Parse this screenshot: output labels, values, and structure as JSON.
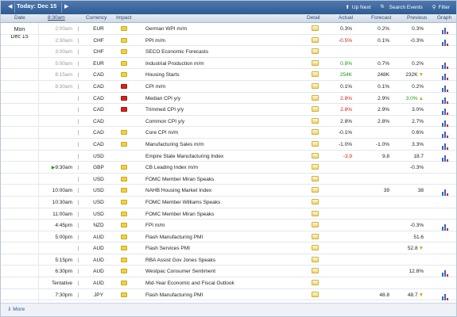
{
  "nav": {
    "prev_icon": "◀",
    "today": "Today: Dec 15",
    "next_icon": "▶",
    "up_next": "Up Next",
    "search": "Search Events",
    "filter": "Filter"
  },
  "columns": {
    "date": "Date",
    "time": "8:30am",
    "currency": "Currency",
    "impact": "Impact",
    "event": "",
    "detail": "Detail",
    "actual": "Actual",
    "forecast": "Forecast",
    "previous": "Previous",
    "graph": "Graph"
  },
  "date_cell": {
    "line1": "Mon",
    "line2": "Dec 15"
  },
  "colors": {
    "green": "#14a014",
    "red": "#d41a1a",
    "low": "#f2d23a",
    "medium": "#f39a2a",
    "high": "#d9221a"
  },
  "rows": [
    {
      "time": "2:00am",
      "cur": "EUR",
      "imp": "low",
      "event": "German WPI m/m",
      "actual": "0.3%",
      "act_color": "",
      "fc": "0.2%",
      "prev": "0.3%",
      "prev_color": "",
      "rev": "",
      "graph": true
    },
    {
      "time": "2:30am",
      "cur": "CHF",
      "imp": "low",
      "event": "PPI m/m",
      "actual": "-0.5%",
      "act_color": "red",
      "fc": "0.1%",
      "prev": "-0.3%",
      "prev_color": "",
      "rev": "",
      "graph": true
    },
    {
      "time": "3:00am",
      "cur": "CHF",
      "imp": "low",
      "event": "SECO Economic Forecasts",
      "actual": "",
      "act_color": "",
      "fc": "",
      "prev": "",
      "prev_color": "",
      "rev": "",
      "graph": false
    },
    {
      "time": "5:00am",
      "cur": "EUR",
      "imp": "low",
      "event": "Industrial Production m/m",
      "actual": "0.8%",
      "act_color": "green",
      "fc": "0.7%",
      "prev": "0.2%",
      "prev_color": "",
      "rev": "",
      "graph": true
    },
    {
      "time": "8:15am",
      "cur": "CAD",
      "imp": "low",
      "event": "Housing Starts",
      "actual": "254K",
      "act_color": "green",
      "fc": "248K",
      "prev": "232K",
      "prev_color": "",
      "rev": "▼",
      "graph": true
    },
    {
      "time": "8:30am",
      "cur": "CAD",
      "imp": "high",
      "event": "CPI m/m",
      "actual": "0.1%",
      "act_color": "",
      "fc": "0.1%",
      "prev": "0.2%",
      "prev_color": "",
      "rev": "",
      "graph": true
    },
    {
      "time": "",
      "cur": "CAD",
      "imp": "high",
      "event": "Median CPI y/y",
      "actual": "2.8%",
      "act_color": "red",
      "fc": "2.9%",
      "prev": "3.0%",
      "prev_color": "green",
      "rev": "▲",
      "graph": true
    },
    {
      "time": "",
      "cur": "CAD",
      "imp": "high",
      "event": "Trimmed CPI y/y",
      "actual": "2.8%",
      "act_color": "red",
      "fc": "2.9%",
      "prev": "3.0%",
      "prev_color": "",
      "rev": "",
      "graph": true
    },
    {
      "time": "",
      "cur": "CAD",
      "imp": "medium",
      "event": "Common CPI y/y",
      "actual": "2.8%",
      "act_color": "",
      "fc": "2.8%",
      "prev": "2.7%",
      "prev_color": "",
      "rev": "",
      "graph": true
    },
    {
      "time": "",
      "cur": "CAD",
      "imp": "low",
      "event": "Core CPI m/m",
      "actual": "-0.1%",
      "act_color": "",
      "fc": "",
      "prev": "0.6%",
      "prev_color": "",
      "rev": "",
      "graph": true
    },
    {
      "time": "",
      "cur": "CAD",
      "imp": "low",
      "event": "Manufacturing Sales m/m",
      "actual": "-1.0%",
      "act_color": "",
      "fc": "-1.0%",
      "prev": "3.3%",
      "prev_color": "",
      "rev": "",
      "graph": true
    },
    {
      "time": "",
      "cur": "USD",
      "imp": "medium",
      "event": "Empire State Manufacturing Index",
      "actual": "-3.9",
      "act_color": "red",
      "fc": "9.8",
      "prev": "18.7",
      "prev_color": "",
      "rev": "",
      "graph": true
    },
    {
      "time": "9:30am",
      "cur": "GBP",
      "imp": "low",
      "event": "CB Leading Index m/m",
      "actual": "",
      "act_color": "",
      "fc": "",
      "prev": "-0.3%",
      "prev_color": "",
      "rev": "",
      "graph": false,
      "upnext": true
    },
    {
      "time": "",
      "cur": "USD",
      "imp": "low",
      "event": "FOMC Member Miran Speaks",
      "actual": "",
      "act_color": "",
      "fc": "",
      "prev": "",
      "prev_color": "",
      "rev": "",
      "graph": false
    },
    {
      "time": "10:00am",
      "cur": "USD",
      "imp": "low",
      "event": "NAHB Housing Market Index",
      "actual": "",
      "act_color": "",
      "fc": "39",
      "prev": "38",
      "prev_color": "",
      "rev": "",
      "graph": true
    },
    {
      "time": "10:30am",
      "cur": "USD",
      "imp": "low",
      "event": "FOMC Member Williams Speaks",
      "actual": "",
      "act_color": "",
      "fc": "",
      "prev": "",
      "prev_color": "",
      "rev": "",
      "graph": false
    },
    {
      "time": "11:00am",
      "cur": "USD",
      "imp": "low",
      "event": "FOMC Member Miran Speaks",
      "actual": "",
      "act_color": "",
      "fc": "",
      "prev": "",
      "prev_color": "",
      "rev": "",
      "graph": false
    },
    {
      "time": "4:45pm",
      "cur": "NZD",
      "imp": "low",
      "event": "FPI m/m",
      "actual": "",
      "act_color": "",
      "fc": "",
      "prev": "-0.3%",
      "prev_color": "",
      "rev": "",
      "graph": true
    },
    {
      "time": "5:00pm",
      "cur": "AUD",
      "imp": "low",
      "event": "Flash Manufacturing PMI",
      "actual": "",
      "act_color": "",
      "fc": "",
      "prev": "51.6",
      "prev_color": "",
      "rev": "",
      "graph": false
    },
    {
      "time": "",
      "cur": "AUD",
      "imp": "low",
      "event": "Flash Services PMI",
      "actual": "",
      "act_color": "",
      "fc": "",
      "prev": "52.8",
      "prev_color": "",
      "rev": "▼",
      "graph": false
    },
    {
      "time": "5:15pm",
      "cur": "AUD",
      "imp": "low",
      "event": "RBA Assist Gov Jones Speaks",
      "actual": "",
      "act_color": "",
      "fc": "",
      "prev": "",
      "prev_color": "",
      "rev": "",
      "graph": false
    },
    {
      "time": "6:30pm",
      "cur": "AUD",
      "imp": "low",
      "event": "Westpac Consumer Sentiment",
      "actual": "",
      "act_color": "",
      "fc": "",
      "prev": "12.8%",
      "prev_color": "",
      "rev": "",
      "graph": true
    },
    {
      "time": "Tentative",
      "cur": "AUD",
      "imp": "low",
      "event": "Mid-Year Economic and Fiscal Outlook",
      "actual": "",
      "act_color": "",
      "fc": "",
      "prev": "",
      "prev_color": "",
      "rev": "",
      "graph": false
    },
    {
      "time": "7:30pm",
      "cur": "JPY",
      "imp": "low",
      "event": "Flash Manufacturing PMI",
      "actual": "",
      "act_color": "",
      "fc": "48.8",
      "prev": "48.7",
      "prev_color": "",
      "rev": "▼",
      "graph": true
    }
  ],
  "footer": {
    "more": "More"
  }
}
